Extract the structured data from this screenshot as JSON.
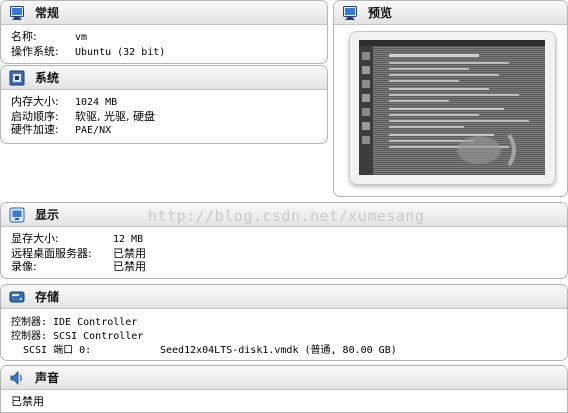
{
  "general": {
    "title": "常规",
    "name_label": "名称:",
    "name_value": "vm",
    "os_label": "操作系统:",
    "os_value": "Ubuntu (32 bit)"
  },
  "system": {
    "title": "系统",
    "memory_label": "内存大小:",
    "memory_value": "1024 MB",
    "boot_label": "启动顺序:",
    "boot_value": "软驱, 光驱, 硬盘",
    "accel_label": "硬件加速:",
    "accel_value": "PAE/NX"
  },
  "preview": {
    "title": "预览"
  },
  "display": {
    "title": "显示",
    "vram_label": "显存大小:",
    "vram_value": "12 MB",
    "rdp_label": "远程桌面服务器:",
    "rdp_value": "已禁用",
    "capture_label": "录像:",
    "capture_value": "已禁用"
  },
  "storage": {
    "title": "存储",
    "controller1": "控制器: IDE Controller",
    "controller2": "控制器: SCSI Controller",
    "port_label": "SCSI 端口 0:",
    "port_value": "Seed12x04LTS-disk1.vmdk (普通, 80.00 GB)"
  },
  "audio": {
    "title": "声音",
    "value": "已禁用"
  },
  "watermark": "http://blog.csdn.net/xumesang",
  "colors": {
    "panel_border": "#b4b4b4",
    "header_top": "#fbfbfb",
    "header_bottom": "#e3e3e3",
    "icon_blue": "#2a5fb0"
  }
}
